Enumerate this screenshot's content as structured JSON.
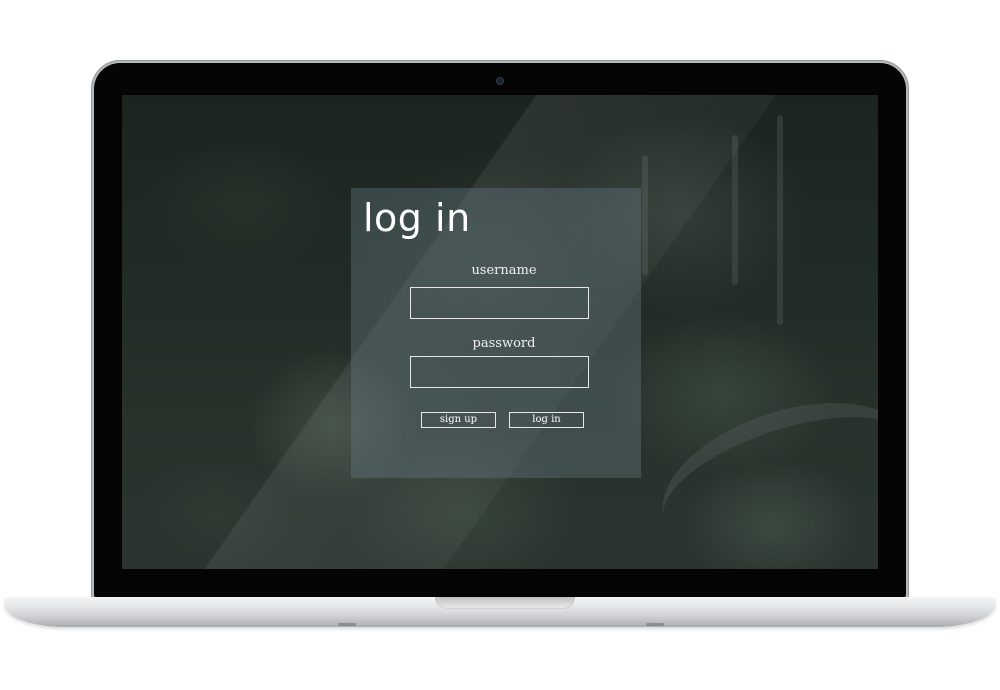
{
  "device": {
    "icon": "laptop-icon"
  },
  "login": {
    "title": "log in",
    "username_label": "username",
    "username_value": "",
    "password_label": "password",
    "password_value": "",
    "signup_label": "sign up",
    "login_label": "log in"
  },
  "colors": {
    "panel": "#6e828c",
    "text": "#ffffff",
    "border": "#e6e6e6"
  }
}
